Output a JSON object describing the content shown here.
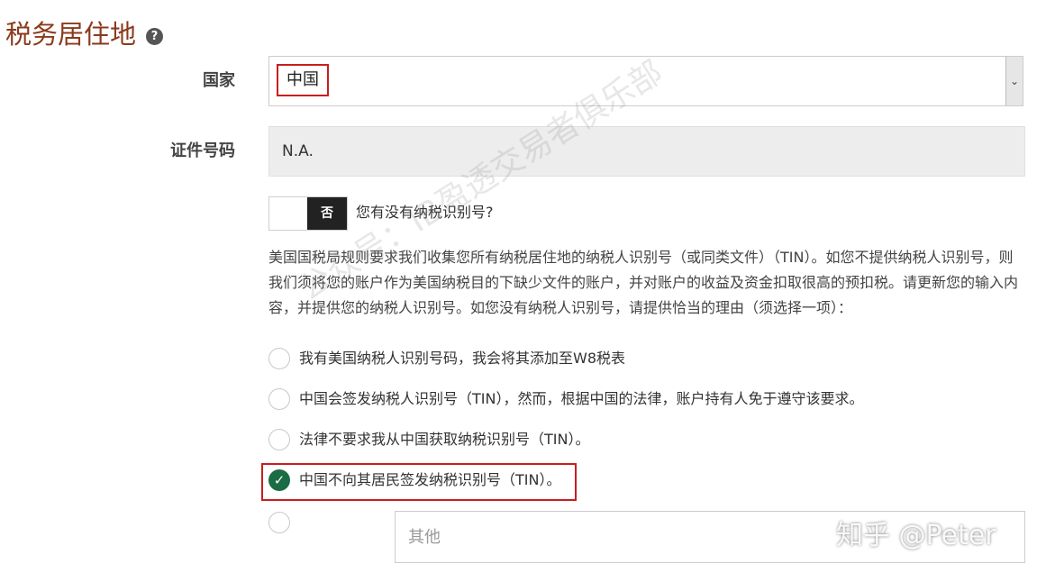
{
  "section": {
    "title": "税务居住地",
    "help_icon": "question-circle-icon",
    "help_glyph": "?"
  },
  "country": {
    "label": "国家",
    "value": "中国",
    "arrow_glyph": "⌄"
  },
  "id_number": {
    "label": "证件号码",
    "value": "N.A."
  },
  "tin_toggle": {
    "state_label": "否",
    "question": "您有没有纳税识别号?"
  },
  "description": "美国国税局规则要求我们收集您所有纳税居住地的纳税人识别号（或同类文件）（TIN）。如您不提供纳税人识别号，则我们须将您的账户作为美国纳税目的下缺少文件的账户，并对账户的收益及资金扣取很高的预扣税。请更新您的输入内容，并提供您的纳税人识别号。如您没有纳税人识别号，请提供恰当的理由（须选择一项）：",
  "reasons": [
    {
      "label": "我有美国纳税人识别号码，我会将其添加至W8税表",
      "checked": false
    },
    {
      "label": "中国会签发纳税人识别号（TIN），然而，根据中国的法律，账户持有人免于遵守该要求。",
      "checked": false
    },
    {
      "label": "法律不要求我从中国获取纳税识别号（TIN）。",
      "checked": false
    },
    {
      "label": "中国不向其居民签发纳税识别号（TIN）。",
      "checked": true
    }
  ],
  "check_glyph": "✓",
  "other": {
    "placeholder": "其他"
  },
  "watermarks": {
    "diagonal": "公众号：IB盈透交易者俱乐部",
    "corner": "知乎 @Peter"
  },
  "colors": {
    "title": "#8b3a1c",
    "highlight_border": "#c81e1e",
    "checked_radio": "#1b6b45",
    "toggle_knob": "#222222"
  }
}
